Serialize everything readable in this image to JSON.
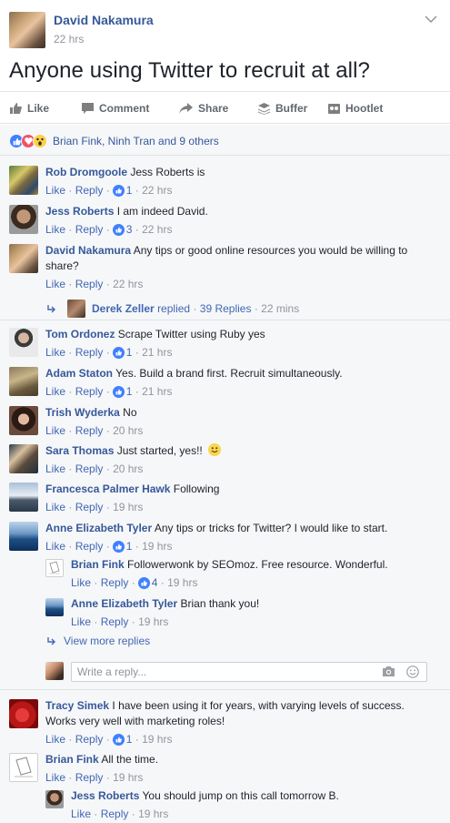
{
  "post": {
    "author": "David Nakamura",
    "time": "22 hrs",
    "text": "Anyone using Twitter to recruit at all?"
  },
  "actions": {
    "like": "Like",
    "comment": "Comment",
    "share": "Share",
    "buffer": "Buffer",
    "hootlet": "Hootlet"
  },
  "reactions": {
    "text": "Brian Fink, Ninh Tran and 9 others"
  },
  "labels": {
    "like": "Like",
    "reply": "Reply",
    "dot": "·"
  },
  "comments": [
    {
      "name": "Rob Dromgoole",
      "text": "Jess Roberts is",
      "likes": "1",
      "time": "22 hrs"
    },
    {
      "name": "Jess Roberts",
      "text": "I am indeed David.",
      "likes": "3",
      "time": "22 hrs"
    },
    {
      "name": "David Nakamura",
      "text": "Any tips or good online resources you would be willing to",
      "text2": "share?",
      "likes": "",
      "time": "22 hrs"
    },
    {
      "name": "Tom Ordonez",
      "text": "Scrape Twitter using Ruby yes",
      "likes": "1",
      "time": "21 hrs"
    },
    {
      "name": "Adam Staton",
      "text": "Yes. Build a brand first. Recruit simultaneously.",
      "likes": "1",
      "time": "21 hrs"
    },
    {
      "name": "Trish Wyderka",
      "text": "No",
      "likes": "",
      "time": "20 hrs"
    },
    {
      "name": "Sara Thomas",
      "text": "Just started, yes!!",
      "likes": "",
      "time": "20 hrs"
    },
    {
      "name": "Francesca Palmer Hawk",
      "text": "Following",
      "likes": "",
      "time": "19 hrs"
    },
    {
      "name": "Anne Elizabeth Tyler",
      "text": "Any tips or tricks for Twitter? I would like to start.",
      "likes": "1",
      "time": "19 hrs"
    },
    {
      "name": "Brian Fink",
      "text": "Followerwonk by SEOmoz. Free resource. Wonderful.",
      "likes": "4",
      "time": "19 hrs"
    },
    {
      "name": "Anne Elizabeth Tyler",
      "text": "Brian thank you!",
      "likes": "",
      "time": "19 hrs"
    },
    {
      "name": "Tracy Simek",
      "text": "I have been using it for years, with varying levels of success.",
      "text2": "Works very well with marketing roles!",
      "likes": "1",
      "time": "19 hrs"
    },
    {
      "name": "Brian Fink",
      "text": "All the time.",
      "likes": "",
      "time": "19 hrs"
    },
    {
      "name": "Jess Roberts",
      "text": "You should jump on this call tomorrow B.",
      "likes": "",
      "time": "19 hrs"
    }
  ],
  "replied": {
    "name": "Derek Zeller",
    "replied": "replied",
    "replies": "39 Replies",
    "time": "22 mins"
  },
  "view_more": "View more replies",
  "reply_placeholder": "Write a reply..."
}
